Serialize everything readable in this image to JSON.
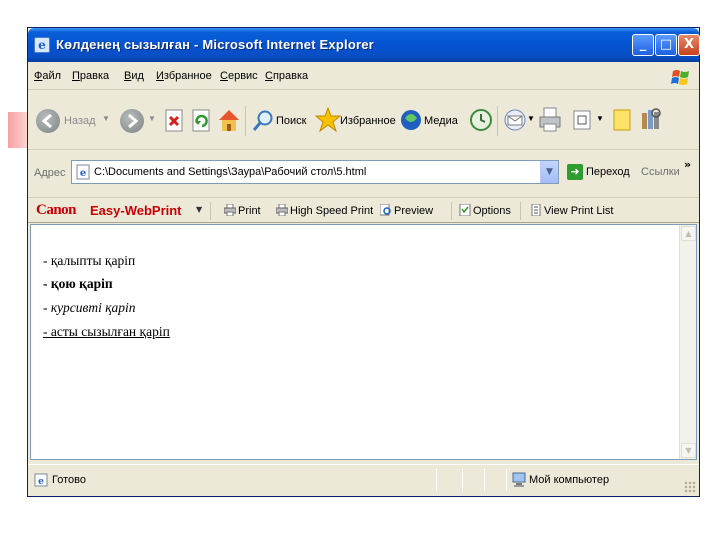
{
  "window": {
    "title": "Көлденең сызылған - Microsoft Internet Explorer",
    "min_glyph": "_",
    "max_glyph": "□",
    "close_glyph": "X"
  },
  "menu": {
    "items": [
      "Файл",
      "Правка",
      "Вид",
      "Избранное",
      "Сервис",
      "Справка"
    ]
  },
  "toolbar": {
    "back_label": "Назад",
    "search_label": "Поиск",
    "favorites_label": "Избранное",
    "media_label": "Медиа"
  },
  "address": {
    "label": "Адрес",
    "value": "C:\\Documents and Settings\\Заура\\Рабочий стол\\5.html",
    "go_label": "Переход",
    "links_label": "Ссылки",
    "more_glyph": "»"
  },
  "canon": {
    "brand": "Canon",
    "product": "Easy-WebPrint",
    "print": "Print",
    "high_speed": "High Speed Print",
    "preview": "Preview",
    "options": "Options",
    "view_list": "View Print List"
  },
  "content": {
    "lines": [
      "- қалыпты қаріп",
      "- қою қаріп",
      "- курсивті қаріп",
      "- асты сызылған қаріп"
    ]
  },
  "status": {
    "text": "Готово",
    "zone": "Мой компьютер"
  },
  "colors": {
    "titlebar": "#0553d1",
    "canon_red": "#cc0000",
    "chrome": "#ece9d8"
  }
}
